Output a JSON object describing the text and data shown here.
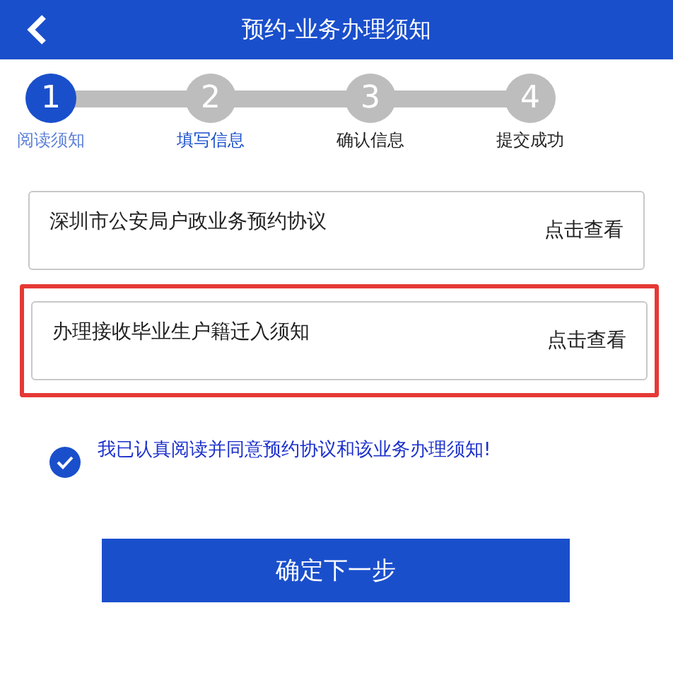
{
  "header": {
    "title": "预约-业务办理须知"
  },
  "steps": [
    {
      "number": "1",
      "label": "阅读须知",
      "selected": true,
      "color": "#5b7fd6"
    },
    {
      "number": "2",
      "label": "填写信息",
      "selected": false,
      "color": "#1a4fcc"
    },
    {
      "number": "3",
      "label": "确认信息",
      "selected": false,
      "color": "#222222"
    },
    {
      "number": "4",
      "label": "提交成功",
      "selected": false,
      "color": "#222222"
    }
  ],
  "documents": [
    {
      "title": "深圳市公安局户政业务预约协议",
      "link": "点击查看",
      "highlighted": false
    },
    {
      "title": "办理接收毕业生户籍迁入须知",
      "link": "点击查看",
      "highlighted": true
    }
  ],
  "agreement": {
    "text": "我已认真阅读并同意预约协议和该业务办理须知!",
    "checked": true
  },
  "next_button": "确定下一步"
}
